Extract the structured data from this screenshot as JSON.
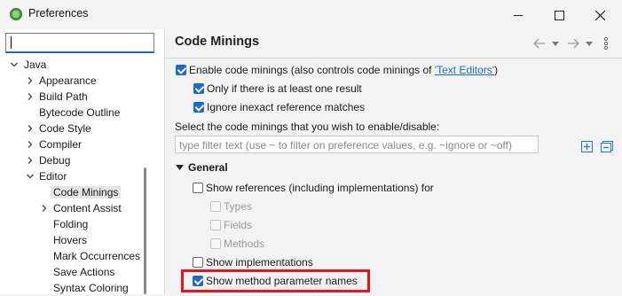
{
  "window": {
    "title": "Preferences",
    "app_icon": "eclipse-icon",
    "controls": [
      "minimize-icon",
      "maximize-icon",
      "close-icon"
    ]
  },
  "sidebar": {
    "filter_value": "",
    "items": [
      {
        "label": "Java",
        "level": 0,
        "expand": "expanded"
      },
      {
        "label": "Appearance",
        "level": 1,
        "expand": "collapsed"
      },
      {
        "label": "Build Path",
        "level": 1,
        "expand": "collapsed"
      },
      {
        "label": "Bytecode Outline",
        "level": 1,
        "expand": "none"
      },
      {
        "label": "Code Style",
        "level": 1,
        "expand": "collapsed"
      },
      {
        "label": "Compiler",
        "level": 1,
        "expand": "collapsed"
      },
      {
        "label": "Debug",
        "level": 1,
        "expand": "collapsed"
      },
      {
        "label": "Editor",
        "level": 1,
        "expand": "expanded"
      },
      {
        "label": "Code Minings",
        "level": 2,
        "expand": "none",
        "selected": true
      },
      {
        "label": "Content Assist",
        "level": 2,
        "expand": "collapsed"
      },
      {
        "label": "Folding",
        "level": 2,
        "expand": "none"
      },
      {
        "label": "Hovers",
        "level": 2,
        "expand": "none"
      },
      {
        "label": "Mark Occurrences",
        "level": 2,
        "expand": "none"
      },
      {
        "label": "Save Actions",
        "level": 2,
        "expand": "none"
      },
      {
        "label": "Syntax Coloring",
        "level": 2,
        "expand": "none"
      }
    ]
  },
  "page": {
    "title": "Code Minings",
    "nav_icons": [
      "back-arrow-icon",
      "back-dropdown-icon",
      "forward-arrow-icon",
      "forward-dropdown-icon",
      "more-options-icon"
    ],
    "enable": {
      "checked": true,
      "label": "Enable code minings (also controls code minings of ",
      "link": "'Text Editors'",
      "suffix": ")"
    },
    "only_if_result": {
      "checked": true,
      "label": "Only if there is at least one result"
    },
    "ignore_inexact": {
      "checked": true,
      "label": "Ignore inexact reference matches"
    },
    "select_text": "Select the code minings that you wish to enable/disable:",
    "filter_placeholder": "type filter text (use ~ to filter on preference values, e.g. ~ignore or ~off)",
    "tool_icons": [
      "expand-all-icon",
      "collapse-all-icon"
    ],
    "section": "General",
    "show_references": {
      "checked": false,
      "label": "Show references (including implementations) for"
    },
    "sub_options": [
      {
        "label": "Types",
        "checked": false,
        "disabled": true
      },
      {
        "label": "Fields",
        "checked": false,
        "disabled": true
      },
      {
        "label": "Methods",
        "checked": false,
        "disabled": true
      }
    ],
    "show_implementations": {
      "checked": false,
      "label": "Show implementations"
    },
    "show_param_names": {
      "checked": true,
      "label": "Show method parameter names"
    },
    "highlight_color": "#e8131e",
    "accent_color": "#1f6ac6"
  }
}
